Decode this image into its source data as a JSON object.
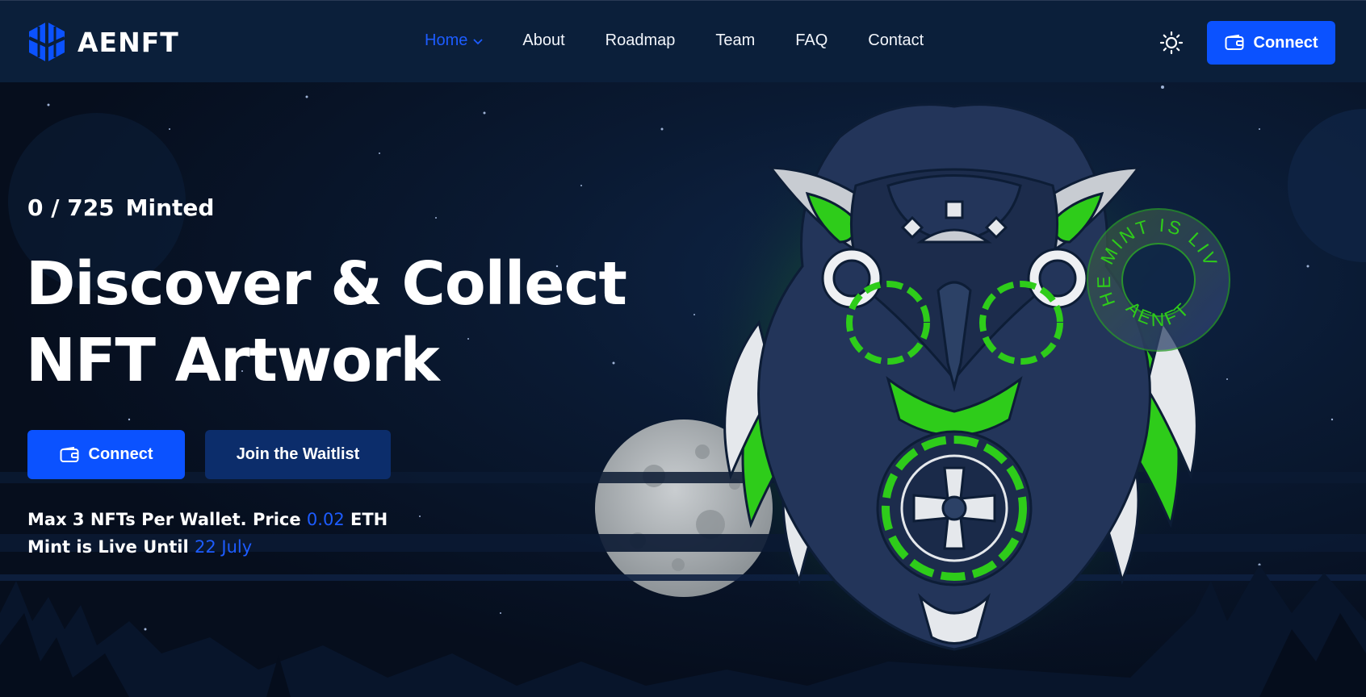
{
  "brand": {
    "name": "AENFT",
    "logo_icon": "hex-cube-logo-icon"
  },
  "nav": {
    "items": [
      {
        "label": "Home",
        "active": true,
        "has_dropdown": true
      },
      {
        "label": "About"
      },
      {
        "label": "Roadmap"
      },
      {
        "label": "Team"
      },
      {
        "label": "FAQ"
      },
      {
        "label": "Contact"
      }
    ],
    "theme_toggle_icon": "sun-icon",
    "connect_label": "Connect"
  },
  "hero": {
    "minted_count": "0 / 725",
    "minted_label": "Minted",
    "headline_line1": "Discover & Collect",
    "headline_line2": "NFT Artwork",
    "connect_label": "Connect",
    "waitlist_label": "Join the Waitlist",
    "info_line1_prefix": "Max 3 NFTs Per Wallet. Price",
    "info_price": "0.02",
    "info_line1_suffix": "ETH",
    "info_line2_prefix": "Mint is Live Until",
    "info_date": "22 July"
  },
  "badge": {
    "top_text": "THE MINT IS LIVE",
    "bottom_text": "AENFT"
  },
  "colors": {
    "accent": "#0b52ff",
    "highlight": "#1d5cff",
    "header_bg": "#0b1f3a",
    "neon_green": "#2ecc1a",
    "owl_navy": "#23355a"
  }
}
